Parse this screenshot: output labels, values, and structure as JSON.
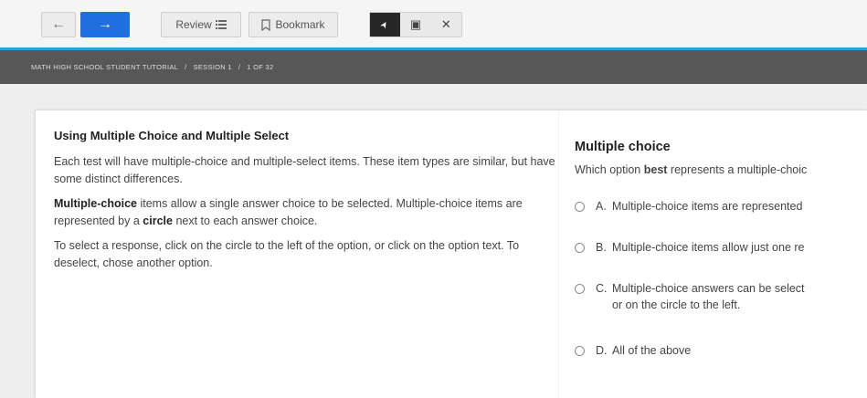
{
  "toolbar": {
    "back_icon": "←",
    "next_icon": "→",
    "review_label": "Review",
    "review_icon": "list-icon",
    "bookmark_label": "Bookmark",
    "bookmark_icon": "bookmark-icon",
    "tools": [
      {
        "name": "pointer",
        "glyph": "➤",
        "active": true
      },
      {
        "name": "calculator",
        "glyph": "▣",
        "active": false
      },
      {
        "name": "cross-out",
        "glyph": "✕",
        "active": false
      }
    ]
  },
  "breadcrumb": {
    "course": "MATH HIGH SCHOOL STUDENT TUTORIAL",
    "separator": "/",
    "session": "SESSION 1",
    "progress": "1 OF 32"
  },
  "passage": {
    "title": "Using Multiple Choice and Multiple Select",
    "p1": "Each test will have multiple-choice and multiple-select items. These item types are similar, but have some distinct differences.",
    "p2_bold": "Multiple-choice",
    "p2_text": " items allow a single answer choice to be selected. Multiple-choice items are represented by a ",
    "p2_bold2": "circle",
    "p2_text2": " next to each answer choice.",
    "p3": "To select a response, click on the circle to the left of the option, or click on the option text. To deselect, chose another option."
  },
  "question": {
    "title": "Multiple choice",
    "prompt_pre": "Which option ",
    "prompt_bold": "best",
    "prompt_post": " represents a multiple-choic",
    "options": [
      {
        "letter": "A.",
        "text": "Multiple-choice items are represented"
      },
      {
        "letter": "B.",
        "text": "Multiple-choice items allow just one re"
      },
      {
        "letter": "C.",
        "text": "Multiple-choice answers can be select",
        "text2": "or on the circle to the left."
      },
      {
        "letter": "D.",
        "text": "All of the above"
      }
    ]
  },
  "colors": {
    "accent": "#2aa2d8",
    "next_button": "#1f6fe0",
    "breadcrumb_bg": "#575757"
  }
}
